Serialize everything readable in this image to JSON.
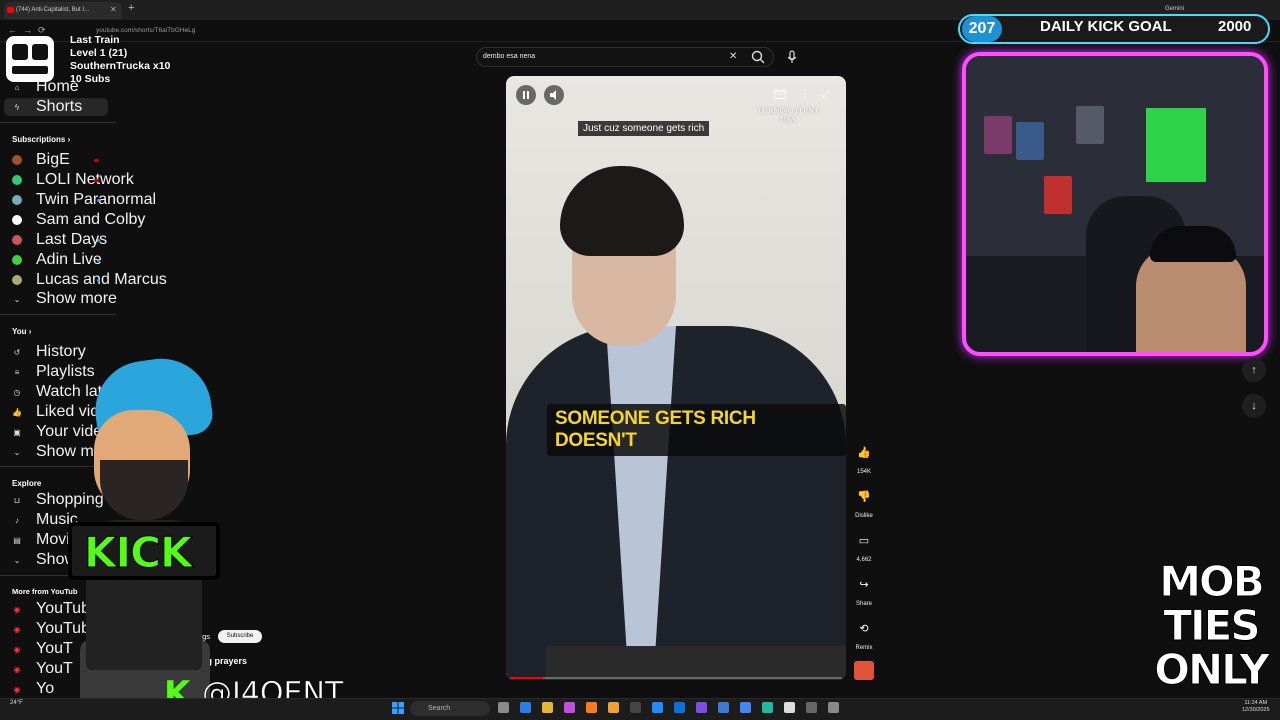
{
  "browser": {
    "tab_title": "(744) Anti-Capitalist, But I...",
    "url": "youtube.com/shorts/T6aiTbGHeLg",
    "gemini_label": "Gemini"
  },
  "overlay": {
    "line1": "Last Train",
    "line2": "Level 1  (21)",
    "line3": "SouthernTrucka x10",
    "line4": "10 Subs",
    "behind_text": "YouTube"
  },
  "sidebar": {
    "main": [
      {
        "label": "Home",
        "icon": "home-icon"
      },
      {
        "label": "Shorts",
        "icon": "shorts-icon"
      }
    ],
    "subscriptions_header": "Subscriptions",
    "subscriptions": [
      {
        "label": "BigE",
        "status": "live",
        "color": "#a0522d"
      },
      {
        "label": "LOLI Network",
        "status": "live",
        "color": "#2ecc71"
      },
      {
        "label": "Twin Paranormal",
        "status": "new",
        "color": "#7ab"
      },
      {
        "label": "Sam and Colby",
        "status": "none",
        "color": "#fff"
      },
      {
        "label": "Last Days",
        "status": "new",
        "color": "#c55"
      },
      {
        "label": "Adin Live",
        "status": "new",
        "color": "#4c4"
      },
      {
        "label": "Lucas and Marcus",
        "status": "new",
        "color": "#aa7"
      }
    ],
    "show_more": "Show more",
    "you_header": "You",
    "you_items": [
      {
        "label": "History",
        "icon": "history-icon"
      },
      {
        "label": "Playlists",
        "icon": "playlists-icon"
      },
      {
        "label": "Watch later",
        "icon": "clock-icon"
      },
      {
        "label": "Liked videos",
        "icon": "thumbs-up-icon"
      },
      {
        "label": "Your videos",
        "icon": "video-icon"
      },
      {
        "label": "Show more",
        "icon": "chevron-down-icon"
      }
    ],
    "explore_header": "Explore",
    "explore_items": [
      {
        "label": "Shopping",
        "icon": "bag-icon"
      },
      {
        "label": "Music",
        "icon": "music-icon"
      },
      {
        "label": "Movie",
        "icon": "film-icon"
      },
      {
        "label": "Show",
        "icon": "chevron-down-icon"
      }
    ],
    "more_header": "More from YouTub",
    "more_items": [
      "YouTube Pr",
      "YouTub",
      "YouT",
      "YouT",
      "Yo"
    ]
  },
  "search": {
    "query": "dembo esa nena"
  },
  "video": {
    "watermark": "TURNING POINT USA",
    "caption_top": "Just cuz someone gets rich",
    "caption_big": "SOMEONE GETS RICH DOESN'T",
    "progress": 0.1,
    "channel": "umperPlugs",
    "subscribe": "Subscribe",
    "title": "art during prayers"
  },
  "actions": [
    {
      "label": "154K",
      "icon": "like-icon"
    },
    {
      "label": "Dislike",
      "icon": "dislike-icon"
    },
    {
      "label": "4,662",
      "icon": "comment-icon"
    },
    {
      "label": "Share",
      "icon": "share-icon"
    },
    {
      "label": "Remix",
      "icon": "remix-icon"
    }
  ],
  "goal": {
    "current": "207",
    "title": "DAILY KICK GOAL",
    "target": "2000"
  },
  "mob_ties": "MOB TIES ONLY",
  "kick": {
    "sign": "KICK",
    "handle_k": "K",
    "handle": "@J4OENT"
  },
  "taskbar": {
    "search": "Search",
    "weather": "24°F",
    "time": "11:24 AM",
    "date": "12/30/2025"
  },
  "colors": {
    "kick_green": "#53fc18",
    "neon_pink": "#ff4dff",
    "caption_yellow": "#f4d62a"
  }
}
